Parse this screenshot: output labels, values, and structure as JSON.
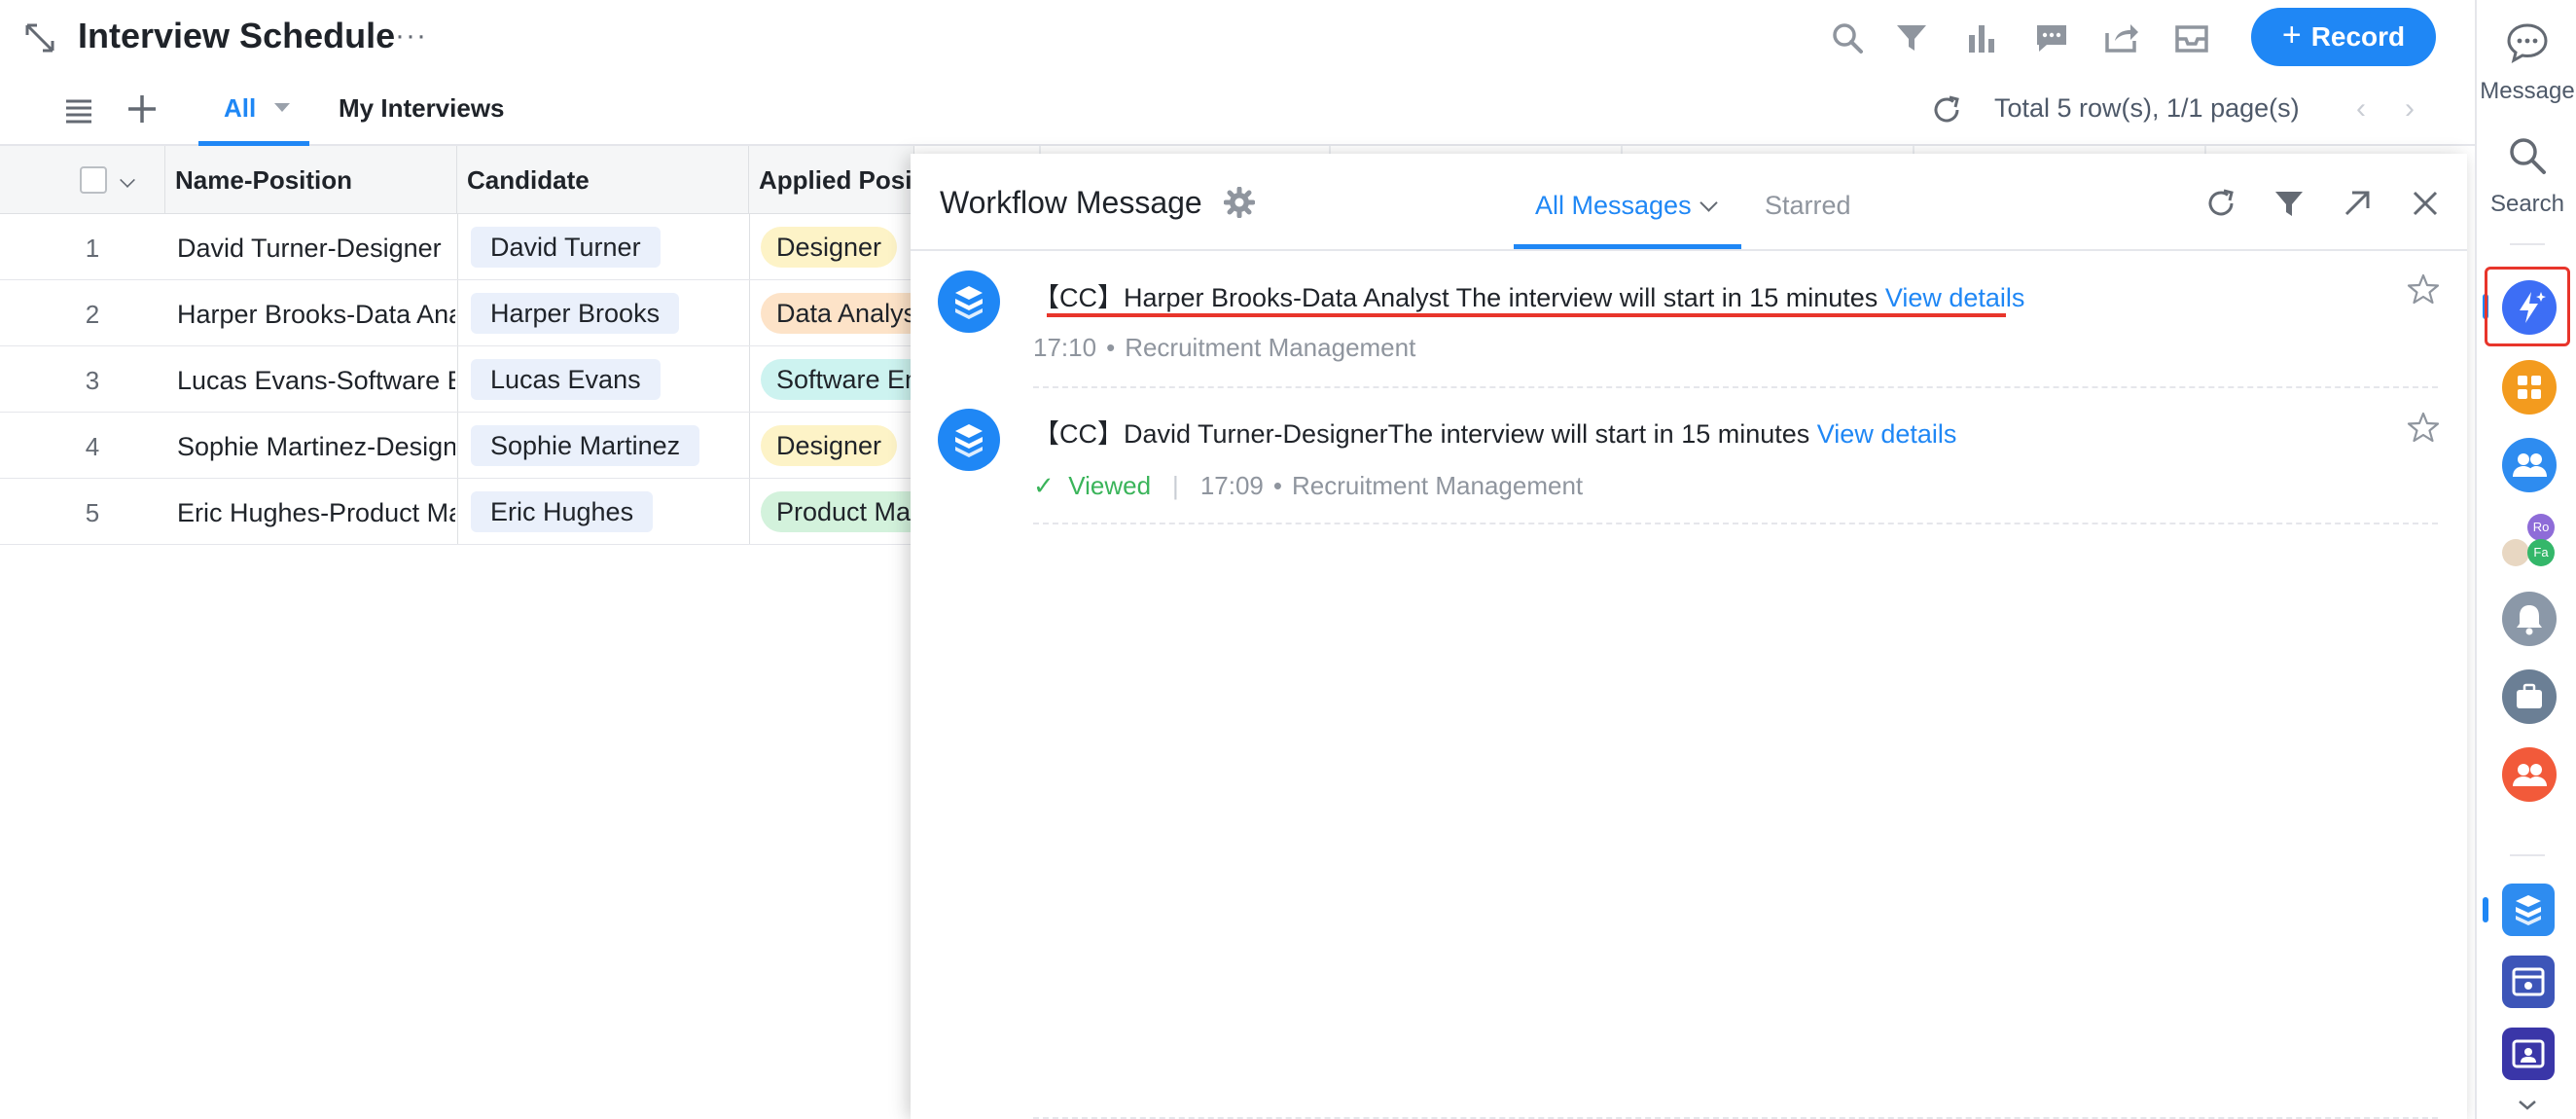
{
  "header": {
    "title": "Interview Schedule",
    "more": "···",
    "record_button": "Record"
  },
  "views": {
    "tab_all": "All",
    "tab_my": "My Interviews",
    "row_count": "Total 5 row(s), 1/1 page(s)"
  },
  "grid": {
    "columns": [
      "Name-Position",
      "Candidate",
      "Applied Posi"
    ],
    "rows": [
      {
        "num": "1",
        "name": "David Turner-Designer",
        "candidate": "David Turner",
        "position": "Designer",
        "pos_color": "#fdf3c7"
      },
      {
        "num": "2",
        "name": "Harper Brooks-Data Ana",
        "candidate": "Harper Brooks",
        "position": "Data Analys",
        "pos_color": "#fde3c8"
      },
      {
        "num": "3",
        "name": "Lucas Evans-Software E",
        "candidate": "Lucas Evans",
        "position": "Software En",
        "pos_color": "#cdf3f0"
      },
      {
        "num": "4",
        "name": "Sophie Martinez-Designe",
        "candidate": "Sophie Martinez",
        "position": "Designer",
        "pos_color": "#fdf3c7"
      },
      {
        "num": "5",
        "name": "Eric Hughes-Product Ma",
        "candidate": "Eric Hughes",
        "position": "Product Man",
        "pos_color": "#d3f2dc"
      }
    ]
  },
  "panel": {
    "title": "Workflow Message",
    "tab_all": "All Messages",
    "tab_starred": "Starred",
    "messages": [
      {
        "text": "【CC】Harper Brooks-Data Analyst The interview will start in 15 minutes ",
        "link": "View details",
        "time": "17:10",
        "source": "Recruitment Management"
      },
      {
        "text": "【CC】David Turner-DesignerThe interview will start in 15 minutes ",
        "link": "View details",
        "status": "Viewed",
        "time": "17:09",
        "source": "Recruitment Management"
      }
    ]
  },
  "dock": {
    "message": "Message",
    "search": "Search",
    "avatar_ro": "Ro",
    "avatar_fa": "Fa"
  },
  "colors": {
    "accent": "#1f87f5",
    "highlight": "#e8352b",
    "viewed": "#3ab45a"
  }
}
